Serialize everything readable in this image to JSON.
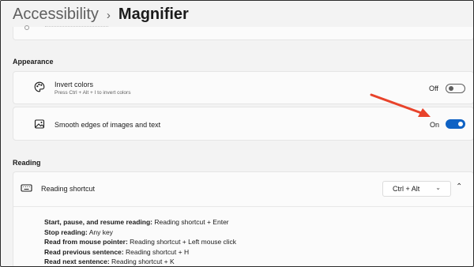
{
  "breadcrumb": {
    "parent": "Accessibility",
    "separator": "›",
    "current": "Magnifier"
  },
  "appearance": {
    "section_label": "Appearance",
    "invert_colors": {
      "title": "Invert colors",
      "subtitle": "Press Ctrl + Alt + I to invert colors",
      "state_label": "Off",
      "enabled": false,
      "icon": "palette-icon"
    },
    "smooth_edges": {
      "title": "Smooth edges of images and text",
      "state_label": "On",
      "enabled": true,
      "icon": "image-icon"
    }
  },
  "reading": {
    "section_label": "Reading",
    "shortcut": {
      "title": "Reading shortcut",
      "selected_value": "Ctrl + Alt",
      "icon": "keyboard-icon",
      "expanded": true
    },
    "shortcuts": [
      {
        "key": "Start, pause, and resume reading:",
        "value": "Reading shortcut + Enter"
      },
      {
        "key": "Stop reading:",
        "value": "Any key"
      },
      {
        "key": "Read from mouse pointer:",
        "value": "Reading shortcut + Left mouse click"
      },
      {
        "key": "Read previous sentence:",
        "value": "Reading shortcut + H"
      },
      {
        "key": "Read next sentence:",
        "value": "Reading shortcut + K"
      }
    ]
  },
  "colors": {
    "accent": "#0e62c4",
    "annotation_arrow": "#e8432b",
    "background": "#f3f3f3",
    "card": "#fbfbfb"
  }
}
